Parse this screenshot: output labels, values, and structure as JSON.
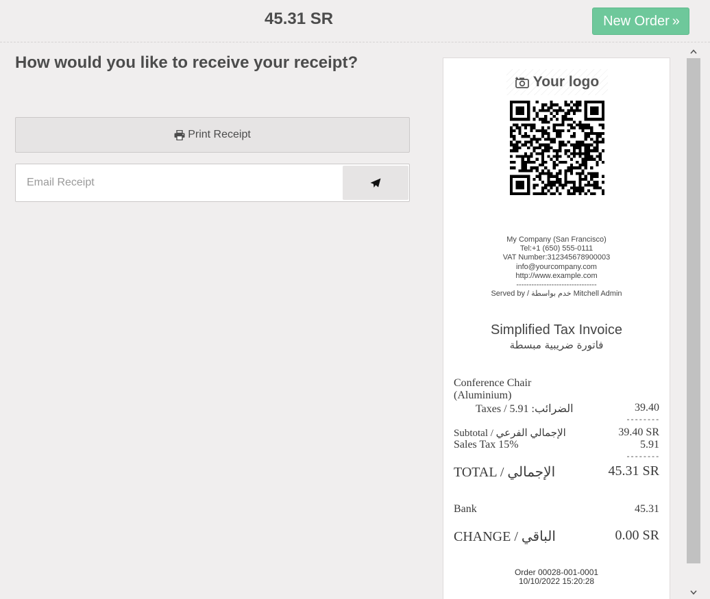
{
  "header": {
    "amount": "45.31 SR",
    "new_order_label": "New Order",
    "new_order_icon": "double-chevron-right-icon"
  },
  "main": {
    "question": "How would you like to receive your receipt?",
    "print_label": "Print Receipt",
    "print_icon": "printer-icon",
    "email_placeholder": "Email Receipt",
    "send_icon": "paper-plane-icon"
  },
  "receipt": {
    "logo_text": "Your logo",
    "logo_icon": "camera-icon",
    "company": {
      "name": "My Company (San Francisco)",
      "tel": "Tel:+1 (650) 555-0111",
      "vat": "VAT Number:312345678900003",
      "email": "info@yourcompany.com",
      "website": "http://www.example.com",
      "separator": "--------------------------------",
      "served_by": "Served by / خدم بواسطة Mitchell Admin"
    },
    "title": "Simplified Tax Invoice",
    "title_ar": "فاتورة ضريبية مبسطة",
    "lines": [
      {
        "product_line1": "Conference Chair",
        "product_line2": "(Aluminium)",
        "taxes": "Taxes / الضرائب: 5.91",
        "price": "39.40"
      }
    ],
    "dash": "--------",
    "subtotal_label": "Subtotal / الإجمالي الفرعي",
    "subtotal_value": "39.40 SR",
    "tax_label": "Sales Tax 15%",
    "tax_value": "5.91",
    "total_label": "TOTAL / الإجمالي",
    "total_value": "45.31 SR",
    "payment_label": "Bank",
    "payment_value": "45.31",
    "change_label": "CHANGE / الباقي",
    "change_value": "0.00 SR",
    "order_ref": "Order 00028-001-0001",
    "order_date": "10/10/2022 15:20:28"
  },
  "scrollbar": {
    "up_icon": "chevron-up-icon",
    "down_icon": "chevron-down-icon"
  }
}
